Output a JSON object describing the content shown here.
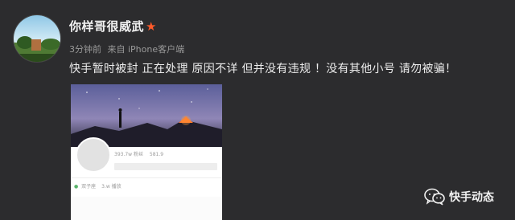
{
  "user": {
    "name": "你样哥很威武",
    "badge_icon": "red-star-icon"
  },
  "meta": {
    "time": "3分钟前",
    "source": "来自 iPhone客户端"
  },
  "post": {
    "text": "快手暂时被封 正在处理 原因不详 但并没有违规 ！没有其他小号 请勿被骗！"
  },
  "screenshot": {
    "stats": [
      "393.7w 粉丝",
      "581.9"
    ],
    "tags": [
      "双子座",
      "3.w 播放"
    ]
  },
  "watermark": {
    "label": "快手动态",
    "icon": "wechat-icon"
  },
  "colors": {
    "background": "#2c2c2e",
    "star": "#ff5a2a",
    "text": "#ececec",
    "meta": "#9a9a9a"
  }
}
